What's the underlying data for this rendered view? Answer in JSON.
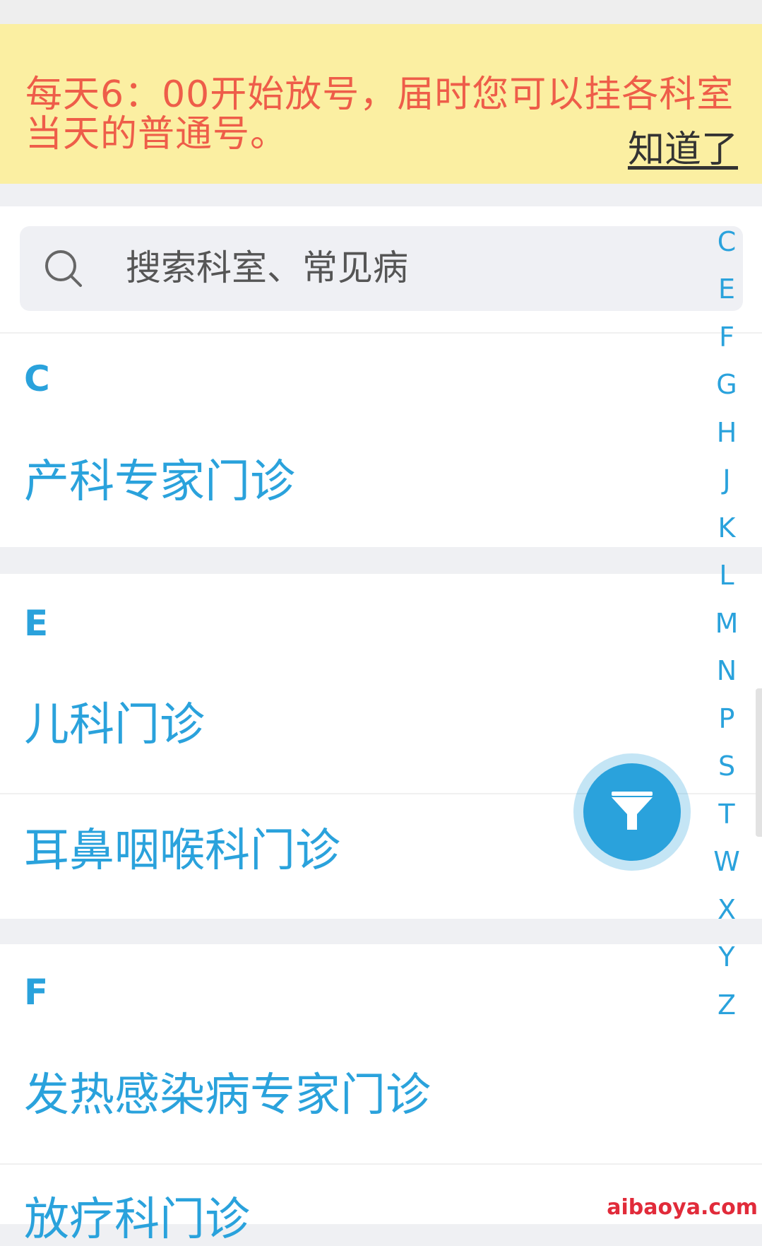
{
  "notice": {
    "message": "每天6：00开始放号，届时您可以挂各科室当天的普通号。",
    "ack_label": "知道了"
  },
  "search": {
    "placeholder": "搜索科室、常见病",
    "value": ""
  },
  "sections": [
    {
      "letter": "C",
      "departments": [
        "产科专家门诊"
      ]
    },
    {
      "letter": "E",
      "departments": [
        "儿科门诊",
        "耳鼻咽喉科门诊"
      ]
    },
    {
      "letter": "F",
      "departments": [
        "发热感染病专家门诊",
        "放疗科门诊"
      ]
    }
  ],
  "index_letters": [
    "C",
    "E",
    "F",
    "G",
    "H",
    "J",
    "K",
    "L",
    "M",
    "N",
    "P",
    "S",
    "T",
    "W",
    "X",
    "Y",
    "Z"
  ],
  "fab": {
    "icon": "filter-icon"
  },
  "watermark": "aibaoya.com",
  "colors": {
    "accent": "#2aa2dc",
    "notice_bg": "#fbefa2",
    "notice_text": "#ee5d49"
  }
}
